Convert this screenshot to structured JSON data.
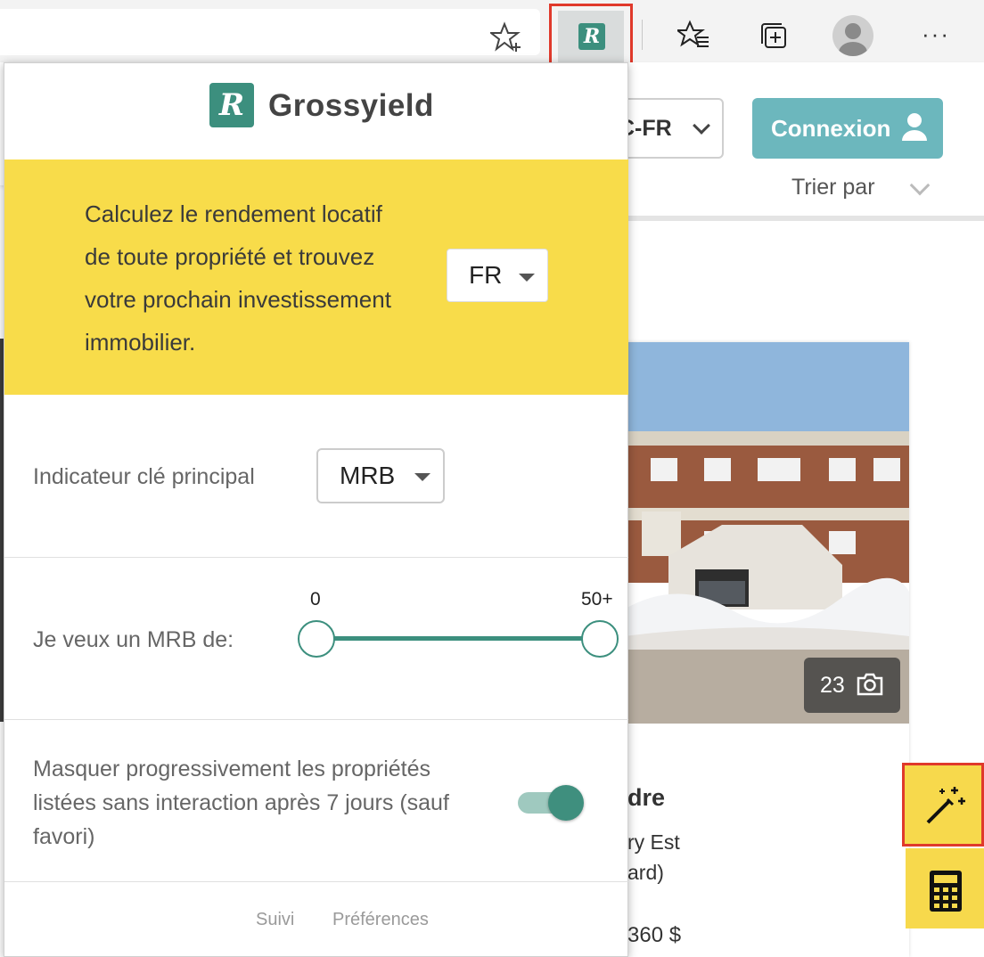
{
  "browser": {
    "icons": [
      "add-favorite-icon",
      "extension-icon",
      "favorites-icon",
      "collections-icon",
      "profile-icon",
      "more-icon"
    ],
    "extension_letter": "R",
    "more_label": "···"
  },
  "site": {
    "lang_selector": "C-FR",
    "login_button": "Connexion",
    "sort_label": "Trier par",
    "listing": {
      "photo_count": "23",
      "title": "dre",
      "address_line1": "ry Est",
      "address_line2": "ard)",
      "price": "360 $"
    }
  },
  "popup": {
    "logo_letter": "R",
    "title": "Grossyield",
    "banner_lines": [
      "Calculez le rendement locatif",
      "de toute propriété et trouvez",
      "votre prochain investissement",
      "immobilier."
    ],
    "language": "FR",
    "kpi_label": "Indicateur clé principal",
    "kpi_value": "MRB",
    "range_label": "Je veux un MRB de:",
    "range_min_label": "0",
    "range_max_label": "50+",
    "range_value": [
      0,
      50
    ],
    "hide_lines": [
      "Masquer progressivement les propriétés",
      "listées sans interaction après 7 jours (sauf",
      "favori)"
    ],
    "hide_enabled": true,
    "footer_links": [
      "Suivi",
      "Préférences"
    ]
  },
  "colors": {
    "brand_green": "#3c8f7e",
    "banner_yellow": "#f8dc4a",
    "login_teal": "#6cb7bd",
    "highlight_red": "#e0392b"
  }
}
